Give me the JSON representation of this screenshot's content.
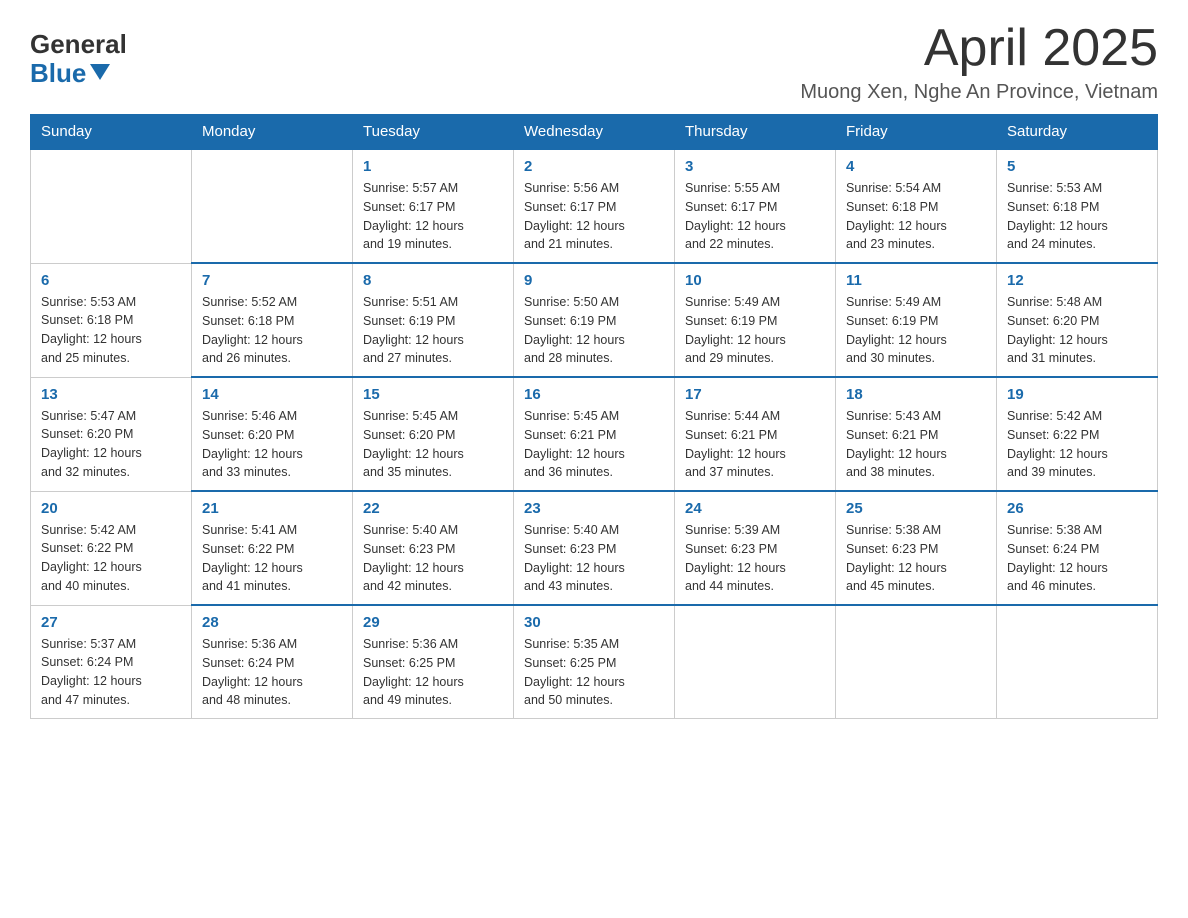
{
  "logo": {
    "general": "General",
    "blue": "Blue"
  },
  "title": "April 2025",
  "subtitle": "Muong Xen, Nghe An Province, Vietnam",
  "weekdays": [
    "Sunday",
    "Monday",
    "Tuesday",
    "Wednesday",
    "Thursday",
    "Friday",
    "Saturday"
  ],
  "weeks": [
    [
      {
        "day": "",
        "info": ""
      },
      {
        "day": "",
        "info": ""
      },
      {
        "day": "1",
        "info": "Sunrise: 5:57 AM\nSunset: 6:17 PM\nDaylight: 12 hours\nand 19 minutes."
      },
      {
        "day": "2",
        "info": "Sunrise: 5:56 AM\nSunset: 6:17 PM\nDaylight: 12 hours\nand 21 minutes."
      },
      {
        "day": "3",
        "info": "Sunrise: 5:55 AM\nSunset: 6:17 PM\nDaylight: 12 hours\nand 22 minutes."
      },
      {
        "day": "4",
        "info": "Sunrise: 5:54 AM\nSunset: 6:18 PM\nDaylight: 12 hours\nand 23 minutes."
      },
      {
        "day": "5",
        "info": "Sunrise: 5:53 AM\nSunset: 6:18 PM\nDaylight: 12 hours\nand 24 minutes."
      }
    ],
    [
      {
        "day": "6",
        "info": "Sunrise: 5:53 AM\nSunset: 6:18 PM\nDaylight: 12 hours\nand 25 minutes."
      },
      {
        "day": "7",
        "info": "Sunrise: 5:52 AM\nSunset: 6:18 PM\nDaylight: 12 hours\nand 26 minutes."
      },
      {
        "day": "8",
        "info": "Sunrise: 5:51 AM\nSunset: 6:19 PM\nDaylight: 12 hours\nand 27 minutes."
      },
      {
        "day": "9",
        "info": "Sunrise: 5:50 AM\nSunset: 6:19 PM\nDaylight: 12 hours\nand 28 minutes."
      },
      {
        "day": "10",
        "info": "Sunrise: 5:49 AM\nSunset: 6:19 PM\nDaylight: 12 hours\nand 29 minutes."
      },
      {
        "day": "11",
        "info": "Sunrise: 5:49 AM\nSunset: 6:19 PM\nDaylight: 12 hours\nand 30 minutes."
      },
      {
        "day": "12",
        "info": "Sunrise: 5:48 AM\nSunset: 6:20 PM\nDaylight: 12 hours\nand 31 minutes."
      }
    ],
    [
      {
        "day": "13",
        "info": "Sunrise: 5:47 AM\nSunset: 6:20 PM\nDaylight: 12 hours\nand 32 minutes."
      },
      {
        "day": "14",
        "info": "Sunrise: 5:46 AM\nSunset: 6:20 PM\nDaylight: 12 hours\nand 33 minutes."
      },
      {
        "day": "15",
        "info": "Sunrise: 5:45 AM\nSunset: 6:20 PM\nDaylight: 12 hours\nand 35 minutes."
      },
      {
        "day": "16",
        "info": "Sunrise: 5:45 AM\nSunset: 6:21 PM\nDaylight: 12 hours\nand 36 minutes."
      },
      {
        "day": "17",
        "info": "Sunrise: 5:44 AM\nSunset: 6:21 PM\nDaylight: 12 hours\nand 37 minutes."
      },
      {
        "day": "18",
        "info": "Sunrise: 5:43 AM\nSunset: 6:21 PM\nDaylight: 12 hours\nand 38 minutes."
      },
      {
        "day": "19",
        "info": "Sunrise: 5:42 AM\nSunset: 6:22 PM\nDaylight: 12 hours\nand 39 minutes."
      }
    ],
    [
      {
        "day": "20",
        "info": "Sunrise: 5:42 AM\nSunset: 6:22 PM\nDaylight: 12 hours\nand 40 minutes."
      },
      {
        "day": "21",
        "info": "Sunrise: 5:41 AM\nSunset: 6:22 PM\nDaylight: 12 hours\nand 41 minutes."
      },
      {
        "day": "22",
        "info": "Sunrise: 5:40 AM\nSunset: 6:23 PM\nDaylight: 12 hours\nand 42 minutes."
      },
      {
        "day": "23",
        "info": "Sunrise: 5:40 AM\nSunset: 6:23 PM\nDaylight: 12 hours\nand 43 minutes."
      },
      {
        "day": "24",
        "info": "Sunrise: 5:39 AM\nSunset: 6:23 PM\nDaylight: 12 hours\nand 44 minutes."
      },
      {
        "day": "25",
        "info": "Sunrise: 5:38 AM\nSunset: 6:23 PM\nDaylight: 12 hours\nand 45 minutes."
      },
      {
        "day": "26",
        "info": "Sunrise: 5:38 AM\nSunset: 6:24 PM\nDaylight: 12 hours\nand 46 minutes."
      }
    ],
    [
      {
        "day": "27",
        "info": "Sunrise: 5:37 AM\nSunset: 6:24 PM\nDaylight: 12 hours\nand 47 minutes."
      },
      {
        "day": "28",
        "info": "Sunrise: 5:36 AM\nSunset: 6:24 PM\nDaylight: 12 hours\nand 48 minutes."
      },
      {
        "day": "29",
        "info": "Sunrise: 5:36 AM\nSunset: 6:25 PM\nDaylight: 12 hours\nand 49 minutes."
      },
      {
        "day": "30",
        "info": "Sunrise: 5:35 AM\nSunset: 6:25 PM\nDaylight: 12 hours\nand 50 minutes."
      },
      {
        "day": "",
        "info": ""
      },
      {
        "day": "",
        "info": ""
      },
      {
        "day": "",
        "info": ""
      }
    ]
  ]
}
